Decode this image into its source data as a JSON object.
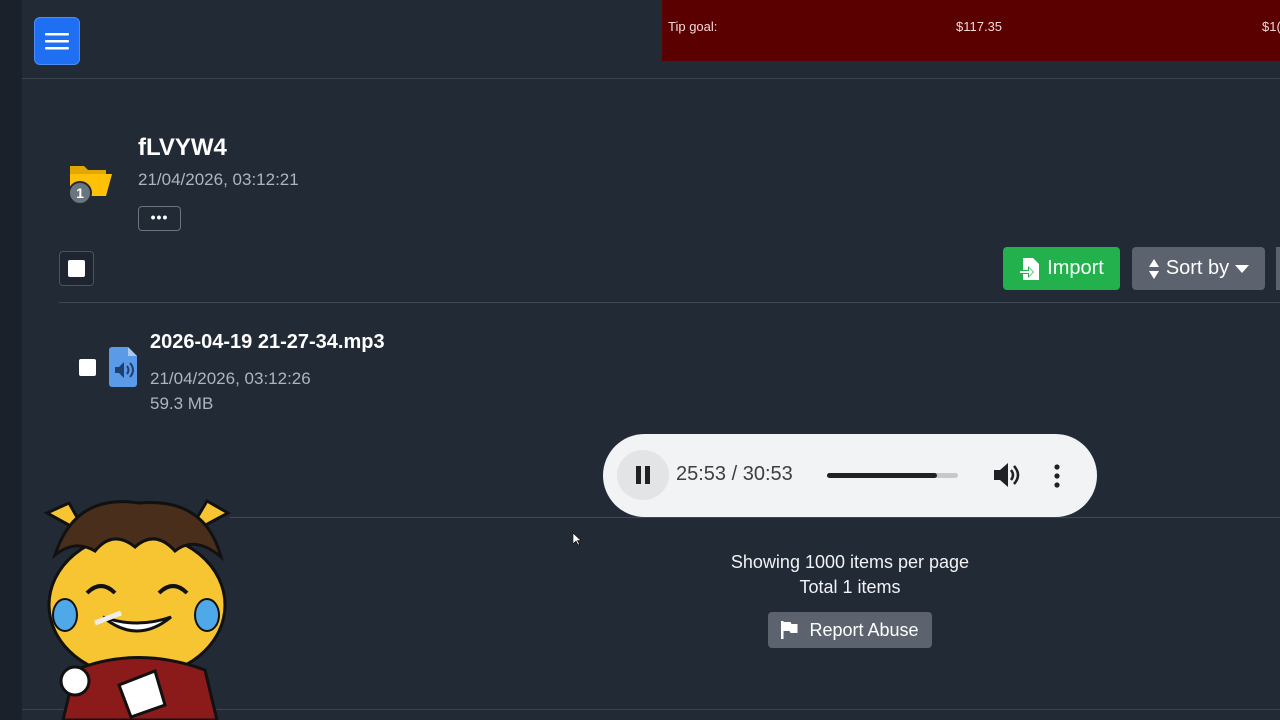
{
  "topbar": {
    "menu_icon": "hamburger-menu-icon",
    "tip_goal": {
      "label": "Tip goal:",
      "amount": "$117.35",
      "amount_partial": "$1("
    }
  },
  "folder": {
    "name": "fLVYW4",
    "date": "21/04/2026, 03:12:21",
    "badge_count": "1",
    "more_label": "•••",
    "icon": "folder-open-icon"
  },
  "toolbar": {
    "import_label": "Import",
    "sort_label": "Sort by",
    "import_color": "#22b14c",
    "sort_color": "#5c636e"
  },
  "files": [
    {
      "name": "2026-04-19 21-27-34.mp3",
      "date": "21/04/2026, 03:12:26",
      "size": "59.3 MB",
      "icon": "audio-file-icon"
    }
  ],
  "player": {
    "time": "25:53 / 30:53",
    "progress_fraction": 0.84,
    "state": "playing"
  },
  "pagination": {
    "per_page_text": "Showing 1000 items per page",
    "total_text": "Total 1 items"
  },
  "report": {
    "label": "Report Abuse",
    "icon": "flag-icon"
  },
  "colors": {
    "background": "#222a36",
    "accent": "#1f6ff2",
    "tip_bar": "#5a0000"
  }
}
